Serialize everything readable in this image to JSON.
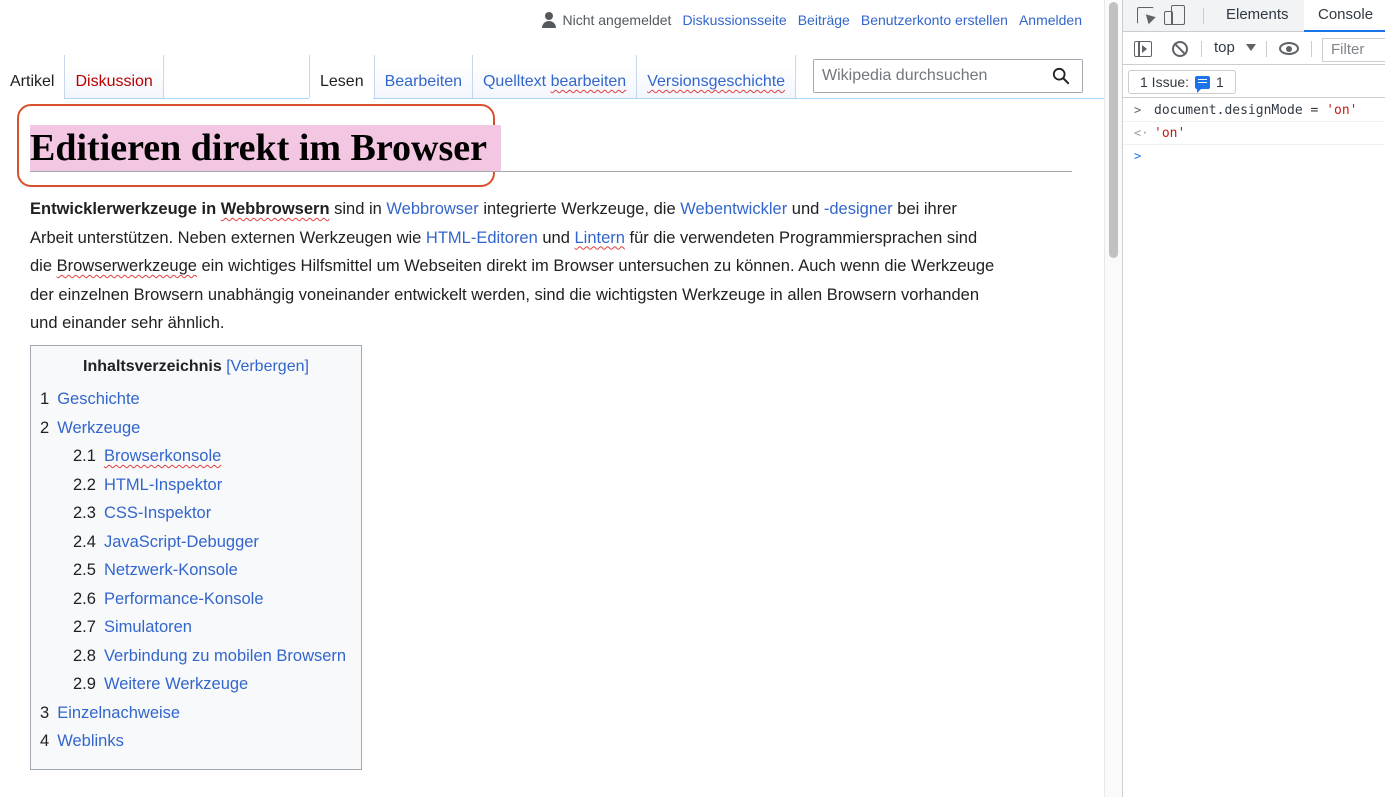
{
  "personal": {
    "status": "Nicht angemeldet",
    "links": [
      "Diskussionsseite",
      "Beiträge",
      "Benutzerkonto erstellen",
      "Anmelden"
    ]
  },
  "tabs": {
    "article": "Artikel",
    "discussion": "Diskussion",
    "read": "Lesen",
    "edit": "Bearbeiten",
    "edit_source": "Quelltext bearbeiten",
    "history": "Versionsgeschichte"
  },
  "search": {
    "placeholder": "Wikipedia durchsuchen"
  },
  "article": {
    "title": "Editieren direkt im Browser",
    "intro": {
      "l1": {
        "b1": "Entwicklerwerkzeuge in ",
        "b2": "Webbrowsern",
        "t1": " sind in ",
        "a1": "Webbrowser",
        "t2": " integrierte Werkzeuge, die ",
        "a2": "Webentwickler",
        "t3": " und ",
        "a3": "-designer",
        "t4": " bei ihrer"
      },
      "l2": {
        "t1": "Arbeit unterstützen. Neben externen Werkzeugen wie ",
        "a1": "HTML-Editoren",
        "t2": " und ",
        "a2": "Lintern",
        "t3": " für die verwendeten Programmiersprachen sind"
      },
      "l3": {
        "t1": "die ",
        "s1": "Browserwerkzeuge",
        "t2": " ein wichtiges Hilfsmittel um Webseiten direkt im Browser untersuchen zu können. Auch wenn die Werkzeuge"
      },
      "l4": "der einzelnen Browsern unabhängig voneinander entwickelt werden, sind die wichtigsten Werkzeuge in allen Browsern vorhanden",
      "l5": "und einander sehr ähnlich."
    }
  },
  "toc": {
    "title": "Inhaltsverzeichnis",
    "toggle": "[Verbergen]",
    "items": [
      {
        "num": "1",
        "label": "Geschichte"
      },
      {
        "num": "2",
        "label": "Werkzeuge"
      },
      {
        "num": "2.1",
        "label": "Browserkonsole"
      },
      {
        "num": "2.2",
        "label": "HTML-Inspektor"
      },
      {
        "num": "2.3",
        "label": "CSS-Inspektor"
      },
      {
        "num": "2.4",
        "label": "JavaScript-Debugger"
      },
      {
        "num": "2.5",
        "label": "Netzwerk-Konsole"
      },
      {
        "num": "2.6",
        "label": "Performance-Konsole"
      },
      {
        "num": "2.7",
        "label": "Simulatoren"
      },
      {
        "num": "2.8",
        "label": "Verbindung zu mobilen Browsern"
      },
      {
        "num": "2.9",
        "label": "Weitere Werkzeuge"
      },
      {
        "num": "3",
        "label": "Einzelnachweise"
      },
      {
        "num": "4",
        "label": "Weblinks"
      }
    ]
  },
  "devtools": {
    "tabs": [
      "Elements",
      "Console"
    ],
    "context": "top",
    "filter_placeholder": "Filter",
    "issues_label": "1 Issue:",
    "issues_count": "1",
    "console": {
      "input_code": "document.designMode = ",
      "input_value": "'on'",
      "result": "'on'"
    }
  },
  "colors": {
    "link": "#3366cc",
    "redlink": "#ba0000",
    "title_highlight": "#f3c6e2",
    "title_outline": "#d9502e",
    "devtools_accent": "#1a73e8"
  }
}
